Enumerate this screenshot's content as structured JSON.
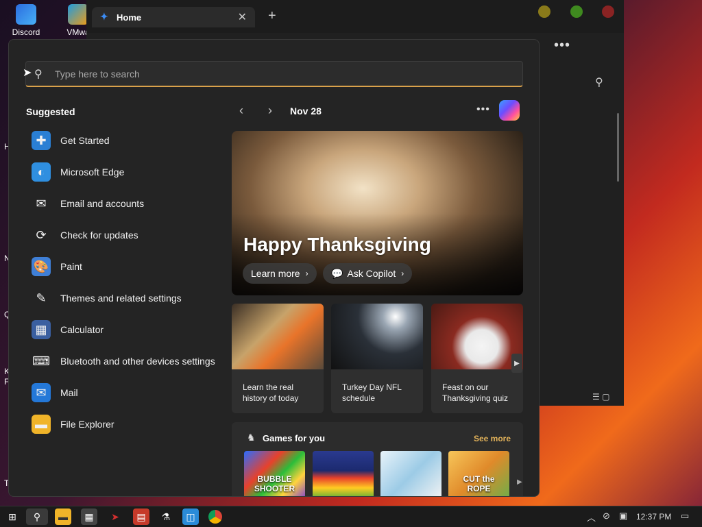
{
  "desktop": {
    "icons": [
      {
        "label": "Discord"
      },
      {
        "label": "VMwa"
      }
    ],
    "edge_letters": [
      "H",
      "N",
      "K",
      "F",
      "T",
      "Q"
    ]
  },
  "browser": {
    "tab_label": "Home",
    "tab_close": "✕",
    "new_tab": "+",
    "more": "•••"
  },
  "search": {
    "placeholder": "Type here to search",
    "value": ""
  },
  "suggested": {
    "title": "Suggested",
    "items": [
      {
        "label": "Get Started",
        "icon": "get-started-icon",
        "color": "#2a7fd4"
      },
      {
        "label": "Microsoft Edge",
        "icon": "edge-icon",
        "color": "#2f8fe0"
      },
      {
        "label": "Email and accounts",
        "icon": "mail-outline-icon",
        "color": "#242424"
      },
      {
        "label": "Check for updates",
        "icon": "refresh-icon",
        "color": "#242424"
      },
      {
        "label": "Paint",
        "icon": "paint-icon",
        "color": "#3f7fd6"
      },
      {
        "label": "Themes and related settings",
        "icon": "brush-icon",
        "color": "#242424"
      },
      {
        "label": "Calculator",
        "icon": "calculator-icon",
        "color": "#3a5fa0"
      },
      {
        "label": "Bluetooth and other devices settings",
        "icon": "devices-icon",
        "color": "#242424"
      },
      {
        "label": "Mail",
        "icon": "mail-icon",
        "color": "#2478d8"
      },
      {
        "label": "File Explorer",
        "icon": "folder-icon",
        "color": "#f0b429"
      }
    ]
  },
  "feed": {
    "date": "Nov 28",
    "nav_prev": "‹",
    "nav_next": "›",
    "more": "•••",
    "hero": {
      "title": "Happy Thanksgiving",
      "learn_more": "Learn more",
      "ask_copilot": "Ask Copilot"
    },
    "cards": [
      {
        "caption": "Learn the real history of today"
      },
      {
        "caption": "Turkey Day NFL schedule"
      },
      {
        "caption": "Feast on our Thanksgiving quiz"
      }
    ],
    "games": {
      "title": "Games for you",
      "see_more": "See more",
      "tiles": [
        {
          "label": "BUBBLE SHOOTER"
        },
        {
          "label": ""
        },
        {
          "label": ""
        },
        {
          "label": "CUT the ROPE"
        }
      ]
    }
  },
  "taskbar": {
    "time": "12:37 PM"
  },
  "colors": {
    "accent_search": "#d9a14b",
    "see_more": "#e3b35a",
    "panel_bg": "#242424"
  }
}
